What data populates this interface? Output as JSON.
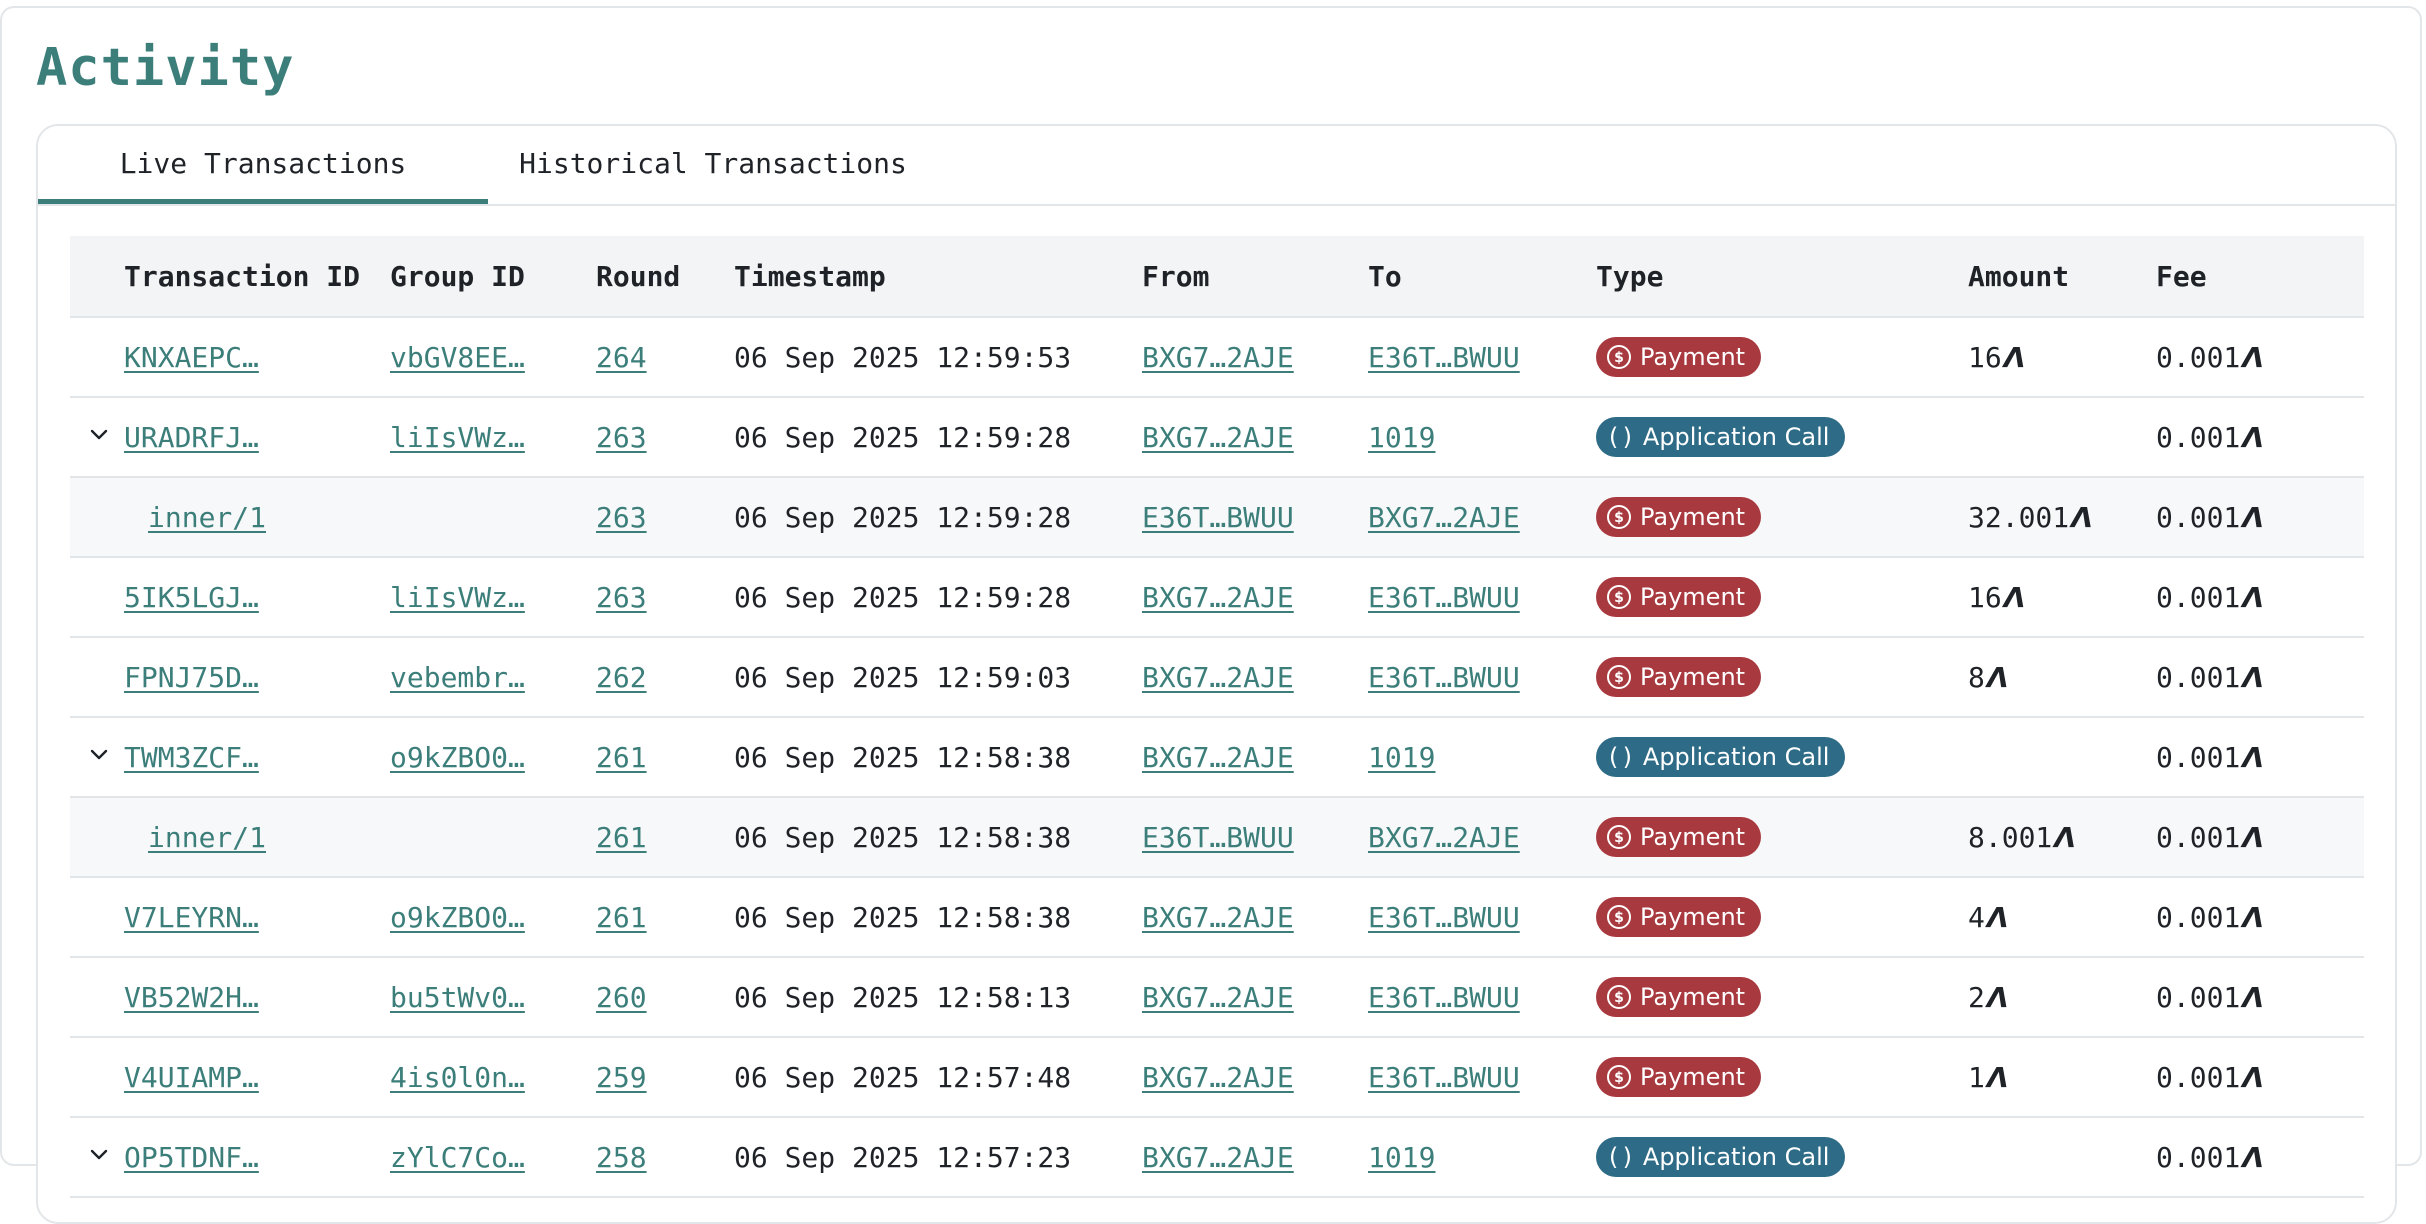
{
  "page": {
    "title": "Activity"
  },
  "tabs": [
    {
      "label": "Live Transactions",
      "active": true
    },
    {
      "label": "Historical Transactions",
      "active": false
    }
  ],
  "table": {
    "headers": [
      "Transaction ID",
      "Group ID",
      "Round",
      "Timestamp",
      "From",
      "To",
      "Type",
      "Amount",
      "Fee"
    ],
    "algo_symbol": "Ʌ",
    "rows": [
      {
        "expandable": false,
        "inner": false,
        "id": "KNXAEPC…",
        "group": "vbGV8EE…",
        "round": "264",
        "timestamp": "06 Sep 2025 12:59:53",
        "from": "BXG7…2AJE",
        "to": "E36T…BWUU",
        "type": "Payment",
        "amount": "16",
        "fee": "0.001"
      },
      {
        "expandable": true,
        "inner": false,
        "id": "URADRFJ…",
        "group": "liIsVWz…",
        "round": "263",
        "timestamp": "06 Sep 2025 12:59:28",
        "from": "BXG7…2AJE",
        "to": "1019",
        "type": "Application Call",
        "amount": "",
        "fee": "0.001"
      },
      {
        "expandable": false,
        "inner": true,
        "id": "inner/1",
        "group": "",
        "round": "263",
        "timestamp": "06 Sep 2025 12:59:28",
        "from": "E36T…BWUU",
        "to": "BXG7…2AJE",
        "type": "Payment",
        "amount": "32.001",
        "fee": "0.001"
      },
      {
        "expandable": false,
        "inner": false,
        "id": "5IK5LGJ…",
        "group": "liIsVWz…",
        "round": "263",
        "timestamp": "06 Sep 2025 12:59:28",
        "from": "BXG7…2AJE",
        "to": "E36T…BWUU",
        "type": "Payment",
        "amount": "16",
        "fee": "0.001"
      },
      {
        "expandable": false,
        "inner": false,
        "id": "FPNJ75D…",
        "group": "vebembr…",
        "round": "262",
        "timestamp": "06 Sep 2025 12:59:03",
        "from": "BXG7…2AJE",
        "to": "E36T…BWUU",
        "type": "Payment",
        "amount": "8",
        "fee": "0.001"
      },
      {
        "expandable": true,
        "inner": false,
        "id": "TWM3ZCF…",
        "group": "o9kZBO0…",
        "round": "261",
        "timestamp": "06 Sep 2025 12:58:38",
        "from": "BXG7…2AJE",
        "to": "1019",
        "type": "Application Call",
        "amount": "",
        "fee": "0.001"
      },
      {
        "expandable": false,
        "inner": true,
        "id": "inner/1",
        "group": "",
        "round": "261",
        "timestamp": "06 Sep 2025 12:58:38",
        "from": "E36T…BWUU",
        "to": "BXG7…2AJE",
        "type": "Payment",
        "amount": "8.001",
        "fee": "0.001"
      },
      {
        "expandable": false,
        "inner": false,
        "id": "V7LEYRN…",
        "group": "o9kZBO0…",
        "round": "261",
        "timestamp": "06 Sep 2025 12:58:38",
        "from": "BXG7…2AJE",
        "to": "E36T…BWUU",
        "type": "Payment",
        "amount": "4",
        "fee": "0.001"
      },
      {
        "expandable": false,
        "inner": false,
        "id": "VB52W2H…",
        "group": "bu5tWv0…",
        "round": "260",
        "timestamp": "06 Sep 2025 12:58:13",
        "from": "BXG7…2AJE",
        "to": "E36T…BWUU",
        "type": "Payment",
        "amount": "2",
        "fee": "0.001"
      },
      {
        "expandable": false,
        "inner": false,
        "id": "V4UIAMP…",
        "group": "4is0l0n…",
        "round": "259",
        "timestamp": "06 Sep 2025 12:57:48",
        "from": "BXG7…2AJE",
        "to": "E36T…BWUU",
        "type": "Payment",
        "amount": "1",
        "fee": "0.001"
      },
      {
        "expandable": true,
        "inner": false,
        "id": "OP5TDNF…",
        "group": "zYlC7Co…",
        "round": "258",
        "timestamp": "06 Sep 2025 12:57:23",
        "from": "BXG7…2AJE",
        "to": "1019",
        "type": "Application Call",
        "amount": "",
        "fee": "0.001"
      }
    ]
  },
  "colors": {
    "accent": "#3c7e7a",
    "payment_badge": "#a83a3f",
    "app_call_badge": "#2e6b86",
    "header_bg": "#f2f4f5",
    "inner_row_bg": "#f7f8f9"
  },
  "icons": {
    "payment": "dollar-circle-icon",
    "application_call": "parentheses-icon",
    "expand": "chevron-down-icon"
  }
}
